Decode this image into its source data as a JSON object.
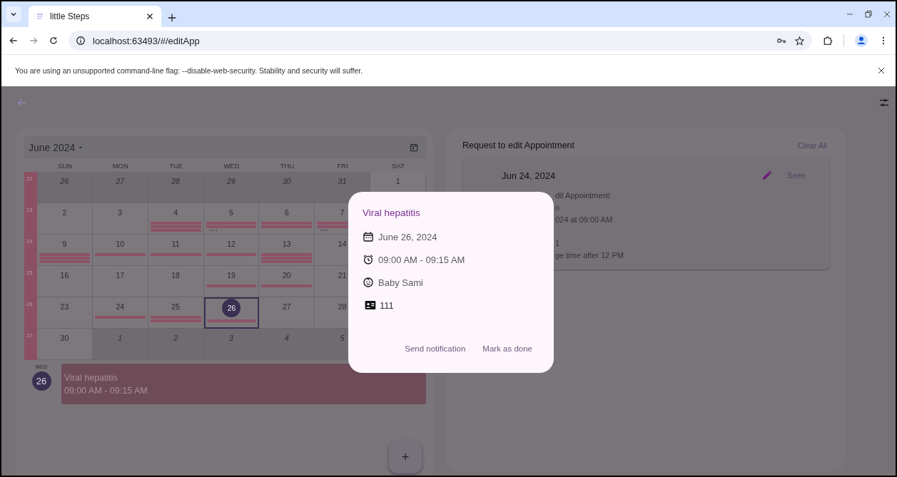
{
  "browser": {
    "tab": {
      "title": "little Steps",
      "selected": true
    },
    "address": "localhost:63493/#/editApp",
    "infobar": "You are using an unsupported command-line flag: --disable-web-security. Stability and security will suffer."
  },
  "calendar": {
    "month": "June 2024",
    "weekdays": [
      "SUN",
      "MON",
      "TUE",
      "WED",
      "THU",
      "FRI",
      "SAT"
    ],
    "weeks": [
      {
        "number": "22",
        "days": [
          {
            "date": "26",
            "muted": true,
            "selected": false
          },
          {
            "date": "27",
            "muted": true,
            "selected": false
          },
          {
            "date": "28",
            "muted": true,
            "selected": false
          },
          {
            "date": "29",
            "muted": true,
            "selected": false
          },
          {
            "date": "30",
            "muted": true,
            "selected": false
          },
          {
            "date": "31",
            "muted": true,
            "selected": false
          },
          {
            "date": "1",
            "muted": false,
            "selected": false
          }
        ]
      },
      {
        "number": "23",
        "days": [
          {
            "date": "2",
            "muted": false,
            "selected": false
          },
          {
            "date": "3",
            "muted": false,
            "selected": false
          },
          {
            "date": "4",
            "muted": false,
            "selected": false,
            "events": [
              {
                "kind": "bar"
              },
              {
                "kind": "bar"
              },
              {
                "kind": "bar"
              }
            ]
          },
          {
            "date": "5",
            "muted": false,
            "selected": false,
            "events": [
              {
                "kind": "bar"
              },
              {
                "kind": "bar"
              },
              {
                "kind": "more"
              }
            ]
          },
          {
            "date": "6",
            "muted": false,
            "selected": false,
            "events": [
              {
                "kind": "bar"
              },
              {
                "kind": "bar"
              }
            ]
          },
          {
            "date": "7",
            "muted": false,
            "selected": false,
            "events": [
              {
                "kind": "bar"
              },
              {
                "kind": "bar"
              },
              {
                "kind": "more"
              }
            ]
          }
        ]
      },
      {
        "number": "24",
        "days": [
          {
            "date": "9",
            "muted": false,
            "selected": false,
            "events": [
              {
                "kind": "bar"
              },
              {
                "kind": "bar"
              },
              {
                "kind": "bar"
              }
            ]
          },
          {
            "date": "10",
            "muted": false,
            "selected": false,
            "events": [
              {
                "kind": "bar"
              }
            ]
          },
          {
            "date": "11",
            "muted": false,
            "selected": false,
            "events": [
              {
                "kind": "bar"
              }
            ]
          },
          {
            "date": "12",
            "muted": false,
            "selected": false,
            "events": [
              {
                "kind": "bar"
              }
            ]
          },
          {
            "date": "13",
            "muted": false,
            "selected": false,
            "events": [
              {
                "kind": "bar"
              },
              {
                "kind": "bar"
              },
              {
                "kind": "bar"
              }
            ]
          },
          {
            "date": "14",
            "muted": false,
            "selected": false
          }
        ]
      },
      {
        "number": "25",
        "days": [
          {
            "date": "16",
            "muted": false,
            "selected": false
          },
          {
            "date": "17",
            "muted": false,
            "selected": false
          },
          {
            "date": "18",
            "muted": false,
            "selected": false
          },
          {
            "date": "19",
            "muted": false,
            "selected": false,
            "events": [
              {
                "kind": "bar"
              }
            ]
          },
          {
            "date": "20",
            "muted": false,
            "selected": false,
            "events": [
              {
                "kind": "bar"
              }
            ]
          },
          {
            "date": "21",
            "muted": false,
            "selected": false
          }
        ]
      },
      {
        "number": "26",
        "days": [
          {
            "date": "23",
            "muted": false,
            "selected": false
          },
          {
            "date": "24",
            "muted": false,
            "selected": false,
            "events": [
              {
                "kind": "bar"
              }
            ]
          },
          {
            "date": "25",
            "muted": false,
            "selected": false,
            "events": [
              {
                "kind": "bar"
              },
              {
                "kind": "bar"
              }
            ]
          },
          {
            "date": "26",
            "muted": false,
            "selected": true,
            "events": [
              {
                "kind": "bar"
              }
            ]
          },
          {
            "date": "27",
            "muted": false,
            "selected": false
          },
          {
            "date": "28",
            "muted": false,
            "selected": false
          }
        ]
      },
      {
        "number": "27",
        "days": [
          {
            "date": "30",
            "muted": false,
            "selected": false
          },
          {
            "date": "1",
            "muted": true,
            "selected": false
          },
          {
            "date": "2",
            "muted": true,
            "selected": false
          },
          {
            "date": "3",
            "muted": true,
            "selected": false
          },
          {
            "date": "4",
            "muted": true,
            "selected": false
          },
          {
            "date": "5",
            "muted": true,
            "selected": false
          }
        ]
      }
    ]
  },
  "agenda": {
    "weekday": "WED",
    "day": "26",
    "events": [
      {
        "title": "Viral hepatitis",
        "time": "09:00 AM - 09:15 AM"
      }
    ]
  },
  "add_button": "+",
  "requests": {
    "title": "Request to edit Appointment",
    "clear": "Clear All",
    "items": [
      {
        "date": "Jun 24, 2024",
        "status": "Seen",
        "lines": [
          "dit Appointment:",
          "o",
          "024 at 09:00 AM",
          "1",
          "ge time after 12 PM"
        ]
      }
    ]
  },
  "dialog": {
    "title": "Viral hepatitis",
    "rows": [
      {
        "kind": "date",
        "text": "June 26, 2024"
      },
      {
        "kind": "time",
        "text": "09:00 AM - 09:15 AM"
      },
      {
        "kind": "patient",
        "text": "Baby Sami"
      },
      {
        "kind": "id",
        "text": "111"
      }
    ],
    "actions": [
      "Send notification",
      "Mark as done"
    ]
  }
}
